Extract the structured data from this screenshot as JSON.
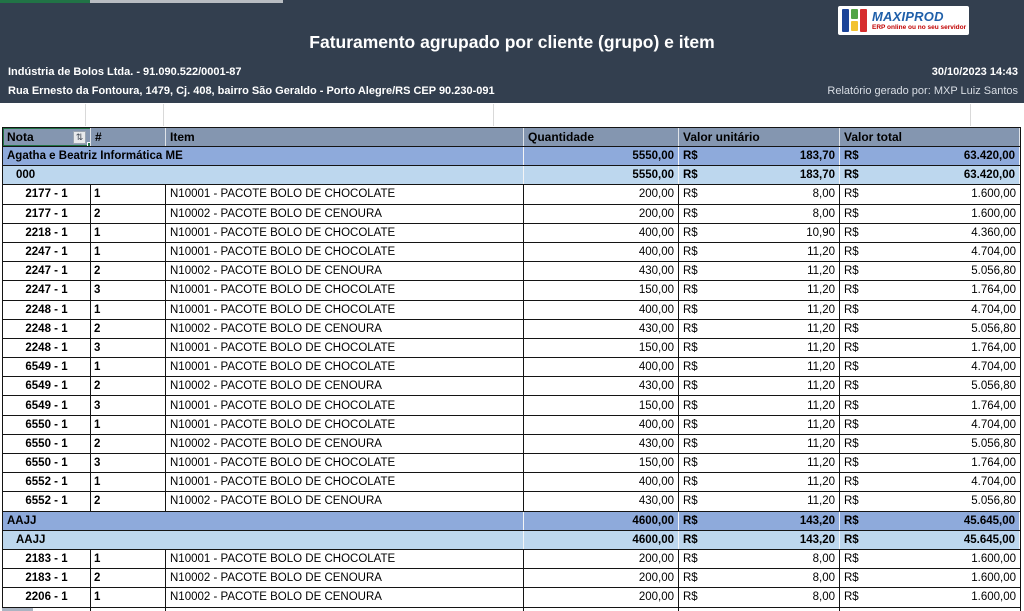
{
  "header": {
    "title": "Faturamento agrupado por cliente (grupo) e item",
    "company_line1": "Indústria de Bolos Ltda. - 91.090.522/0001-87",
    "company_line2": "Rua Ernesto da Fontoura, 1479, Cj. 408, bairro São Geraldo - Porto Alegre/RS CEP 90.230-091",
    "datetime": "30/10/2023 14:43",
    "generated_by": "Relatório gerado por: MXP Luiz Santos",
    "logo": {
      "brand": "MAXIPROD",
      "tagline": "ERP online ou no seu servidor"
    }
  },
  "colors": {
    "band": "#333F4F",
    "header_row": "#8496B0",
    "group_row": "#8EAADB",
    "subgroup_row": "#BDD7EE",
    "selection_green": "#217346",
    "brand_blue": "#1F5FA9",
    "brand_red": "#C00000"
  },
  "table": {
    "currency": "R$",
    "columns": [
      "Nota",
      "#",
      "Item",
      "Quantidade",
      "Valor unitário",
      "Valor total"
    ],
    "sort_filter_icon": "sort-filter",
    "rows": [
      {
        "type": "group",
        "label": "Agatha e Beatriz Informática ME",
        "qty": "5550,00",
        "unit": "183,70",
        "total": "63.420,00"
      },
      {
        "type": "subgroup",
        "label": "000",
        "qty": "5550,00",
        "unit": "183,70",
        "total": "63.420,00"
      },
      {
        "type": "item",
        "nota": "2177 - 1",
        "num": "1",
        "item": "N10001 - PACOTE BOLO DE CHOCOLATE",
        "qty": "200,00",
        "unit": "8,00",
        "total": "1.600,00"
      },
      {
        "type": "item",
        "nota": "2177 - 1",
        "num": "2",
        "item": "N10002 - PACOTE BOLO DE CENOURA",
        "qty": "200,00",
        "unit": "8,00",
        "total": "1.600,00"
      },
      {
        "type": "item",
        "nota": "2218 - 1",
        "num": "1",
        "item": "N10001 - PACOTE BOLO DE CHOCOLATE",
        "qty": "400,00",
        "unit": "10,90",
        "total": "4.360,00"
      },
      {
        "type": "item",
        "nota": "2247 - 1",
        "num": "1",
        "item": "N10001 - PACOTE BOLO DE CHOCOLATE",
        "qty": "400,00",
        "unit": "11,20",
        "total": "4.704,00"
      },
      {
        "type": "item",
        "nota": "2247 - 1",
        "num": "2",
        "item": "N10002 - PACOTE BOLO DE CENOURA",
        "qty": "430,00",
        "unit": "11,20",
        "total": "5.056,80"
      },
      {
        "type": "item",
        "nota": "2247 - 1",
        "num": "3",
        "item": "N10001 - PACOTE BOLO DE CHOCOLATE",
        "qty": "150,00",
        "unit": "11,20",
        "total": "1.764,00"
      },
      {
        "type": "item",
        "nota": "2248 - 1",
        "num": "1",
        "item": "N10001 - PACOTE BOLO DE CHOCOLATE",
        "qty": "400,00",
        "unit": "11,20",
        "total": "4.704,00"
      },
      {
        "type": "item",
        "nota": "2248 - 1",
        "num": "2",
        "item": "N10002 - PACOTE BOLO DE CENOURA",
        "qty": "430,00",
        "unit": "11,20",
        "total": "5.056,80"
      },
      {
        "type": "item",
        "nota": "2248 - 1",
        "num": "3",
        "item": "N10001 - PACOTE BOLO DE CHOCOLATE",
        "qty": "150,00",
        "unit": "11,20",
        "total": "1.764,00"
      },
      {
        "type": "item",
        "nota": "6549 - 1",
        "num": "1",
        "item": "N10001 - PACOTE BOLO DE CHOCOLATE",
        "qty": "400,00",
        "unit": "11,20",
        "total": "4.704,00"
      },
      {
        "type": "item",
        "nota": "6549 - 1",
        "num": "2",
        "item": "N10002 - PACOTE BOLO DE CENOURA",
        "qty": "430,00",
        "unit": "11,20",
        "total": "5.056,80"
      },
      {
        "type": "item",
        "nota": "6549 - 1",
        "num": "3",
        "item": "N10001 - PACOTE BOLO DE CHOCOLATE",
        "qty": "150,00",
        "unit": "11,20",
        "total": "1.764,00"
      },
      {
        "type": "item",
        "nota": "6550 - 1",
        "num": "1",
        "item": "N10001 - PACOTE BOLO DE CHOCOLATE",
        "qty": "400,00",
        "unit": "11,20",
        "total": "4.704,00"
      },
      {
        "type": "item",
        "nota": "6550 - 1",
        "num": "2",
        "item": "N10002 - PACOTE BOLO DE CENOURA",
        "qty": "430,00",
        "unit": "11,20",
        "total": "5.056,80"
      },
      {
        "type": "item",
        "nota": "6550 - 1",
        "num": "3",
        "item": "N10001 - PACOTE BOLO DE CHOCOLATE",
        "qty": "150,00",
        "unit": "11,20",
        "total": "1.764,00"
      },
      {
        "type": "item",
        "nota": "6552 - 1",
        "num": "1",
        "item": "N10001 - PACOTE BOLO DE CHOCOLATE",
        "qty": "400,00",
        "unit": "11,20",
        "total": "4.704,00"
      },
      {
        "type": "item",
        "nota": "6552 - 1",
        "num": "2",
        "item": "N10002 - PACOTE BOLO DE CENOURA",
        "qty": "430,00",
        "unit": "11,20",
        "total": "5.056,80"
      },
      {
        "type": "group",
        "label": "AAJJ",
        "qty": "4600,00",
        "unit": "143,20",
        "total": "45.645,00"
      },
      {
        "type": "subgroup",
        "label": "AAJJ",
        "qty": "4600,00",
        "unit": "143,20",
        "total": "45.645,00"
      },
      {
        "type": "item",
        "nota": "2183 - 1",
        "num": "1",
        "item": "N10001 - PACOTE BOLO DE CHOCOLATE",
        "qty": "200,00",
        "unit": "8,00",
        "total": "1.600,00"
      },
      {
        "type": "item",
        "nota": "2183 - 1",
        "num": "2",
        "item": "N10002 - PACOTE BOLO DE CENOURA",
        "qty": "200,00",
        "unit": "8,00",
        "total": "1.600,00"
      },
      {
        "type": "item",
        "nota": "2206 - 1",
        "num": "1",
        "item": "N10002 - PACOTE BOLO DE CENOURA",
        "qty": "200,00",
        "unit": "8,00",
        "total": "1.600,00"
      }
    ]
  }
}
